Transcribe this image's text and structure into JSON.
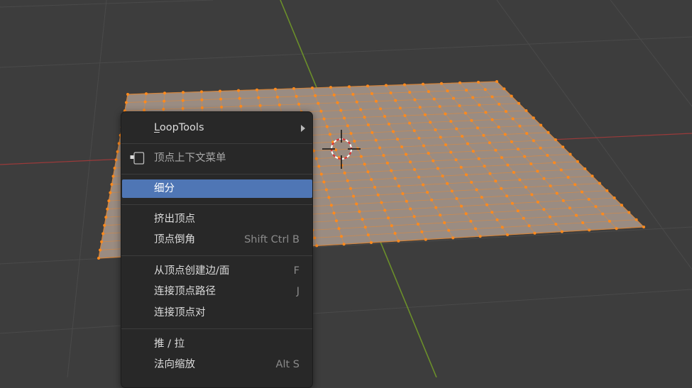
{
  "menu": {
    "loop_tools": {
      "prefix": "L",
      "rest": "oopTools"
    },
    "header": "顶点上下文菜单",
    "items": [
      {
        "label": "细分",
        "shortcut": ""
      },
      {
        "label": "挤出顶点",
        "shortcut": ""
      },
      {
        "label": "顶点倒角",
        "shortcut": "Shift Ctrl B"
      },
      {
        "label": "从顶点创建边/面",
        "shortcut": "F"
      },
      {
        "label": "连接顶点路径",
        "shortcut": "J"
      },
      {
        "label": "连接顶点对",
        "shortcut": ""
      },
      {
        "label": "推 / 拉",
        "shortcut": ""
      },
      {
        "label": "法向缩放",
        "shortcut": "Alt S"
      }
    ]
  },
  "colors": {
    "selection": "#4f76b5",
    "vertex": "#ff8a1c",
    "mesh_face": "#9a8c82",
    "x_axis": "#9a3a3a",
    "y_axis": "#6b8f2a"
  }
}
